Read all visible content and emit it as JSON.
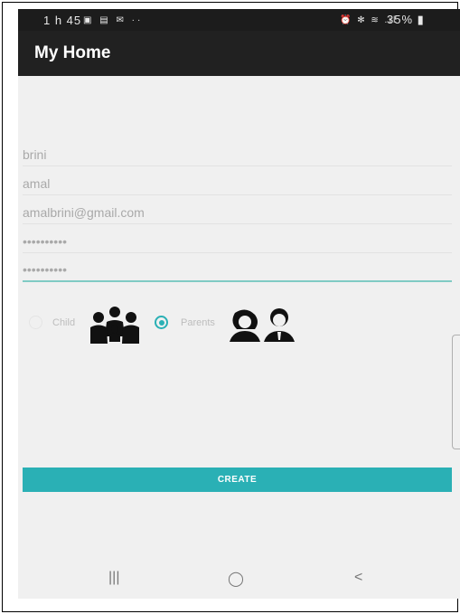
{
  "status_bar": {
    "time": "1 h 45",
    "left_icons": "▣ ▤ ✉ ··",
    "right_icons": "⏰ ✻ ≋ .ıl",
    "battery": "35% ▮"
  },
  "app_bar": {
    "title": "My Home"
  },
  "form": {
    "last_name": "brini",
    "first_name": "amal",
    "email": "amalbrini@gmail.com",
    "password": "••••••••••",
    "confirm_password": "••••••••••"
  },
  "role": {
    "child_label": "Child",
    "parents_label": "Parents",
    "selected": "Parents"
  },
  "create_label": "CREATE",
  "nav": {
    "recents": "|||",
    "home": "◯",
    "back": "<"
  }
}
